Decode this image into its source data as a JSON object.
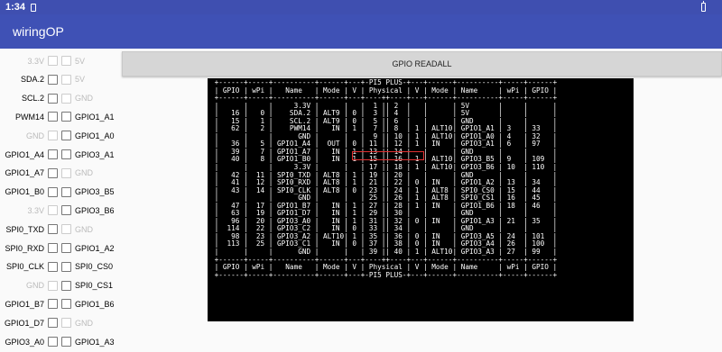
{
  "status_bar": {
    "time": "1:34",
    "sim_icon": "sim-card-icon",
    "battery_icon": "battery-icon"
  },
  "app": {
    "title": "wiringOP"
  },
  "button": {
    "readall_label": "GPIO READALL"
  },
  "pins": [
    {
      "left": "3.3V",
      "left_enabled": false,
      "right": "5V",
      "right_enabled": false
    },
    {
      "left": "SDA.2",
      "left_enabled": true,
      "right": "5V",
      "right_enabled": false
    },
    {
      "left": "SCL.2",
      "left_enabled": true,
      "right": "GND",
      "right_enabled": false
    },
    {
      "left": "PWM14",
      "left_enabled": true,
      "right": "GPIO1_A1",
      "right_enabled": true
    },
    {
      "left": "GND",
      "left_enabled": false,
      "right": "GPIO1_A0",
      "right_enabled": true
    },
    {
      "left": "GPIO1_A4",
      "left_enabled": true,
      "right": "GPIO3_A1",
      "right_enabled": true
    },
    {
      "left": "GPIO1_A7",
      "left_enabled": true,
      "right": "GND",
      "right_enabled": false
    },
    {
      "left": "GPIO1_B0",
      "left_enabled": true,
      "right": "GPIO3_B5",
      "right_enabled": true
    },
    {
      "left": "3.3V",
      "left_enabled": false,
      "right": "GPIO3_B6",
      "right_enabled": true
    },
    {
      "left": "SPI0_TXD",
      "left_enabled": true,
      "right": "GND",
      "right_enabled": false
    },
    {
      "left": "SPI0_RXD",
      "left_enabled": true,
      "right": "GPIO1_A2",
      "right_enabled": true
    },
    {
      "left": "SPI0_CLK",
      "left_enabled": true,
      "right": "SPI0_CS0",
      "right_enabled": true
    },
    {
      "left": "GND",
      "left_enabled": false,
      "right": "SPI0_CS1",
      "right_enabled": true
    },
    {
      "left": "GPIO1_B7",
      "left_enabled": true,
      "right": "GPIO1_B6",
      "right_enabled": true
    },
    {
      "left": "GPIO1_D7",
      "left_enabled": true,
      "right": "GND",
      "right_enabled": false
    },
    {
      "left": "GPIO3_A0",
      "left_enabled": true,
      "right": "GPIO1_A3",
      "right_enabled": true
    }
  ],
  "readall": {
    "header": " +------+-----+----------+------+---+-PI5 PLUS-+---+------+----------+-----+------+",
    "columns": " | GPIO | wPi |   Name   | Mode | V | Physical | V | Mode | Name     | wPi | GPIO |",
    "separator": " +------+-----+----------+------+---+----++----+---+------+----------+-----+------+",
    "rows": [
      " |      |     |     3.3V |      |   |  1 || 2  |   |      | 5V       |     |      |",
      " |   16 |   0 |    SDA.2 | ALT9 | 0 |  3 || 4  |   |      | 5V       |     |      |",
      " |   15 |   1 |    SCL.2 | ALT9 | 0 |  5 || 6  |   |      | GND      |     |      |",
      " |   62 |   2 |    PWM14 |   IN | 1 |  7 || 8  | 1 | ALT10| GPIO1_A1 | 3   | 33   |",
      " |      |     |      GND |      |   |  9 || 10 | 1 | ALT10| GPIO1_A0 | 4   | 32   |",
      " |   36 |   5 | GPIO1_A4 |  OUT | 0 | 11 || 12 | 1 | IN   | GPIO3_A1 | 6   | 97   |",
      " |   39 |   7 | GPIO1_A7 |   IN | 1 | 13 || 14 |   |      | GND      |     |      |",
      " |   40 |   8 | GPIO1_B0 |   IN | 1 | 15 || 16 | 1 | ALT10| GPIO3_B5 | 9   | 109  |",
      " |      |     |     3.3V |      |   | 17 || 18 | 1 | ALT10| GPIO3_B6 | 10  | 110  |",
      " |   42 |  11 | SPI0_TXD | ALT8 | 1 | 19 || 20 |   |      | GND      |     |      |",
      " |   41 |  12 | SPI0_RXD | ALT8 | 1 | 21 || 22 | 0 | IN   | GPIO1_A2 | 13  | 34   |",
      " |   43 |  14 | SPI0_CLK | ALT8 | 0 | 23 || 24 | 1 | ALT8 | SPI0_CS0 | 15  | 44   |",
      " |      |     |      GND |      |   | 25 || 26 | 1 | ALT8 | SPI0_CS1 | 16  | 45   |",
      " |   47 |  17 | GPIO1_B7 |   IN | 1 | 27 || 28 | 1 | IN   | GPIO1_B6 | 18  | 46   |",
      " |   63 |  19 | GPIO1_D7 |   IN | 1 | 29 || 30 |   |      | GND      |     |      |",
      " |   96 |  20 | GPIO3_A0 |   IN | 1 | 31 || 32 | 0 | IN   | GPIO1_A3 | 21  | 35   |",
      " |  114 |  22 | GPIO3_C2 |   IN | 0 | 33 || 34 |   |      | GND      |     |      |",
      " |   98 |  23 | GPIO3_A2 | ALT10| 1 | 35 || 36 | 0 | IN   | GPIO3_A5 | 24  | 101  |",
      " |  113 |  25 | GPIO3_C1 |   IN | 0 | 37 || 38 | 0 | IN   | GPIO3_A4 | 26  | 100  |",
      " |      |     |      GND |      |   | 39 || 40 | 1 | ALT10| GPIO3_A3 | 27  | 99   |"
    ],
    "footer": " +------+-----+----------+------+---+-PI5 PLUS-+---+------+----------+-----+------+"
  }
}
